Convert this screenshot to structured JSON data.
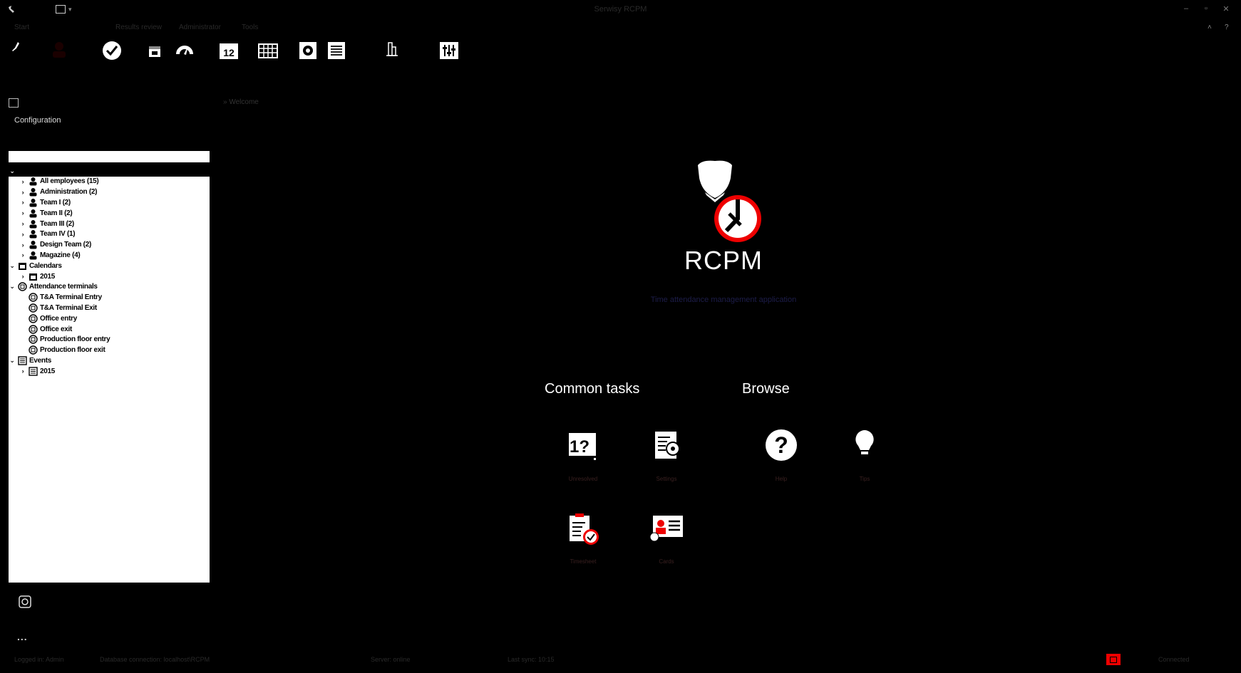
{
  "menu": {
    "items": [
      "Start",
      "Results review",
      "Administrator",
      "Tools"
    ]
  },
  "window": {
    "title": "Serwisy RCPM"
  },
  "left_panel": {
    "header": "Configuration",
    "tree": [
      {
        "label": "",
        "level": 0,
        "expand": "v",
        "icon": "people-icon",
        "selected": true
      },
      {
        "label": "All employees (15)",
        "level": 1,
        "expand": ">",
        "icon": "person-icon"
      },
      {
        "label": "Administration (2)",
        "level": 1,
        "expand": ">",
        "icon": "person-icon"
      },
      {
        "label": "Team I (2)",
        "level": 1,
        "expand": ">",
        "icon": "person-icon"
      },
      {
        "label": "Team II (2)",
        "level": 1,
        "expand": ">",
        "icon": "person-icon"
      },
      {
        "label": "Team III (2)",
        "level": 1,
        "expand": ">",
        "icon": "person-icon"
      },
      {
        "label": "Team IV (1)",
        "level": 1,
        "expand": ">",
        "icon": "person-icon"
      },
      {
        "label": "Design Team (2)",
        "level": 1,
        "expand": ">",
        "icon": "person-icon"
      },
      {
        "label": "Magazine (4)",
        "level": 1,
        "expand": ">",
        "icon": "person-icon"
      },
      {
        "label": "Calendars",
        "level": 0,
        "expand": "v",
        "icon": "calendar-icon"
      },
      {
        "label": "2015",
        "level": 1,
        "expand": ">",
        "icon": "calendar-icon"
      },
      {
        "label": "Attendance terminals",
        "level": 0,
        "expand": "v",
        "icon": "terminal-icon"
      },
      {
        "label": "T&A Terminal Entry",
        "level": 1,
        "expand": "",
        "icon": "terminal-icon"
      },
      {
        "label": "T&A Terminal Exit",
        "level": 1,
        "expand": "",
        "icon": "terminal-icon"
      },
      {
        "label": "Office entry",
        "level": 1,
        "expand": "",
        "icon": "terminal-icon"
      },
      {
        "label": "Office exit",
        "level": 1,
        "expand": "",
        "icon": "terminal-icon"
      },
      {
        "label": "Production floor entry",
        "level": 1,
        "expand": "",
        "icon": "terminal-icon"
      },
      {
        "label": "Production floor exit",
        "level": 1,
        "expand": "",
        "icon": "terminal-icon"
      },
      {
        "label": "Events",
        "level": 0,
        "expand": "v",
        "icon": "events-icon"
      },
      {
        "label": "2015",
        "level": 1,
        "expand": ">",
        "icon": "events-icon"
      }
    ]
  },
  "main": {
    "breadcrumb": "Welcome",
    "brand": "RCPM",
    "tagline": "Time attendance management application",
    "common_tasks_title": "Common tasks",
    "browse_title": "Browse",
    "tiles": [
      {
        "name": "unresolved-tile",
        "label": "Unresolved",
        "icon": "calendar-question-icon"
      },
      {
        "name": "settings-tile",
        "label": "Settings",
        "icon": "document-gear-icon"
      },
      {
        "name": "help-tile",
        "label": "Help",
        "icon": "help-circle-icon"
      },
      {
        "name": "tips-tile",
        "label": "Tips",
        "icon": "lightbulb-icon"
      },
      {
        "name": "timesheet-tile",
        "label": "Timesheet",
        "icon": "clipboard-clock-icon"
      },
      {
        "name": "cards-tile",
        "label": "Cards",
        "icon": "id-card-icon"
      }
    ]
  },
  "status": {
    "segments": [
      "Logged in: Admin",
      "Database connection: localhost\\RCPM",
      "Server: online",
      "Last sync: 10:15"
    ],
    "right_text": "Connected"
  },
  "colors": {
    "background": "#000000",
    "accent": "#e00000",
    "tree_bg": "#ffffff"
  }
}
